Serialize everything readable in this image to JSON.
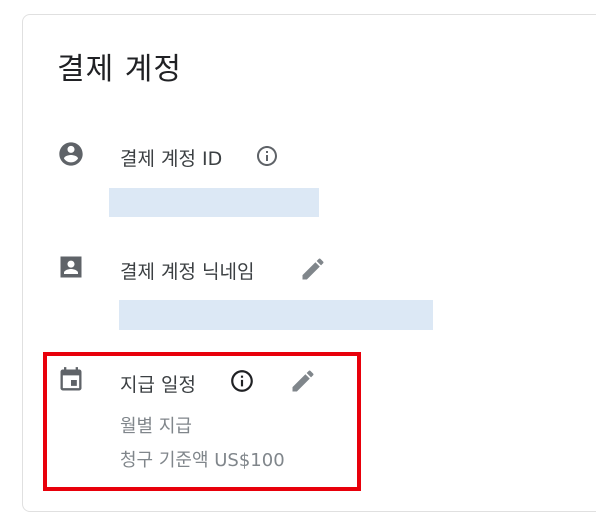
{
  "card": {
    "title": "결제 계정",
    "account_id": {
      "label": "결제 계정 ID",
      "icon": "account-circle-icon",
      "value_redacted": true
    },
    "nickname": {
      "label": "결제 계정 닉네임",
      "icon": "contact-card-icon",
      "value_redacted": true
    },
    "payment_schedule": {
      "label": "지급 일정",
      "icon": "calendar-icon",
      "frequency": "월별 지급",
      "threshold": "청구 기준액 US$100"
    }
  },
  "colors": {
    "highlight": "#e8000b",
    "redaction": "#dce8f5",
    "icon": "#5f6368",
    "text": "#3c4043",
    "muted": "#80868b"
  }
}
